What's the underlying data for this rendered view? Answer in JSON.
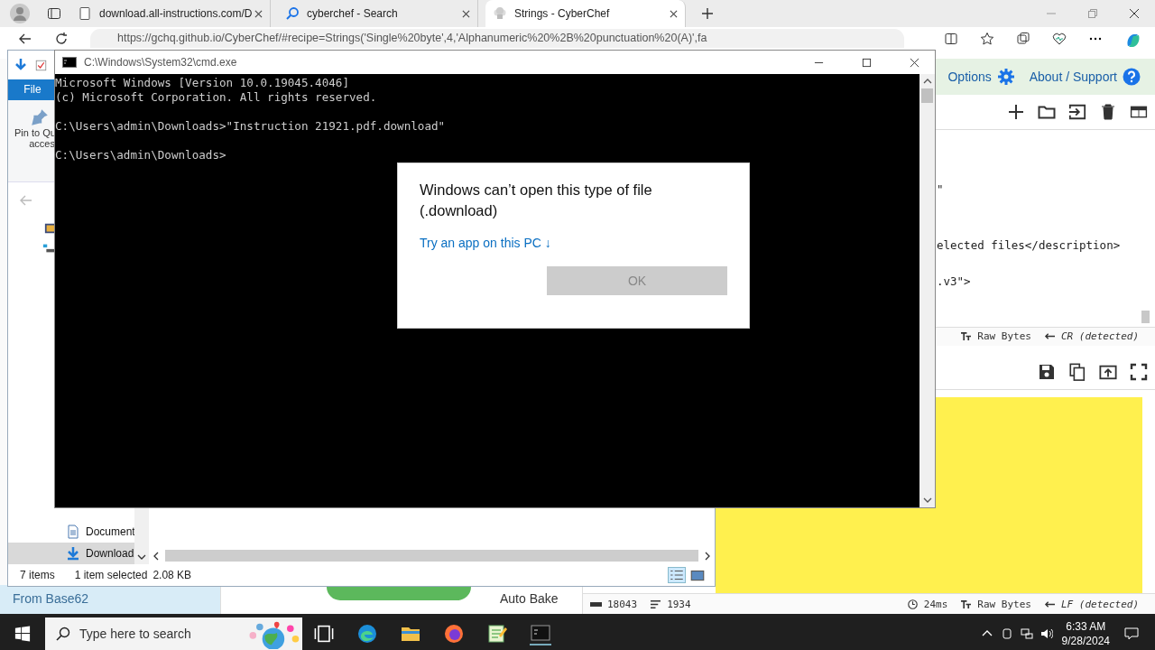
{
  "browser": {
    "tabs": [
      {
        "title": "download.all-instructions.com/D",
        "selected": false
      },
      {
        "title": "cyberchef - Search",
        "selected": false
      },
      {
        "title": "Strings - CyberChef",
        "selected": true
      }
    ],
    "url": "https://gchq.github.io/CyberChef/#recipe=Strings('Single%20byte',4,'Alphanumeric%20%2B%20punctuation%20(A)',fa"
  },
  "cyberchef": {
    "header_links": [
      "Options",
      "About / Support"
    ],
    "input_lines": [
      "\"",
      "elected files</description>",
      ".v3\">"
    ],
    "input_status": {
      "format": "Raw Bytes",
      "eol": "CR (detected)"
    },
    "operation": "From Base62",
    "auto_bake": "Auto Bake",
    "output_status": {
      "length": "18043",
      "lines": "1934",
      "time": "24ms",
      "format": "Raw Bytes",
      "eol": "LF (detected)"
    }
  },
  "explorer": {
    "ribbon_tab": "File",
    "pin_label": [
      "Pin to Qu",
      "acces"
    ],
    "nav_items": [
      {
        "label": "Document",
        "selected": false
      },
      {
        "label": "Download",
        "selected": true
      }
    ],
    "status": {
      "count": "7 items",
      "selection": "1 item selected",
      "size": "2.08 KB"
    }
  },
  "cmd": {
    "title": "C:\\Windows\\System32\\cmd.exe",
    "blocks": [
      [
        "Microsoft Windows [Version 10.0.19045.4046]",
        "(c) Microsoft Corporation. All rights reserved."
      ],
      [
        "C:\\Users\\admin\\Downloads>\"Instruction 21921.pdf.download\""
      ],
      [
        "C:\\Users\\admin\\Downloads>"
      ]
    ]
  },
  "dialog": {
    "title": "Windows can’t open this type of file (.download)",
    "link": "Try an app on this PC ↓",
    "ok": {
      "label": "OK",
      "disabled": true
    }
  },
  "taskbar": {
    "search_placeholder": "Type here to search",
    "time": "6:33 AM",
    "date": "9/28/2024"
  }
}
